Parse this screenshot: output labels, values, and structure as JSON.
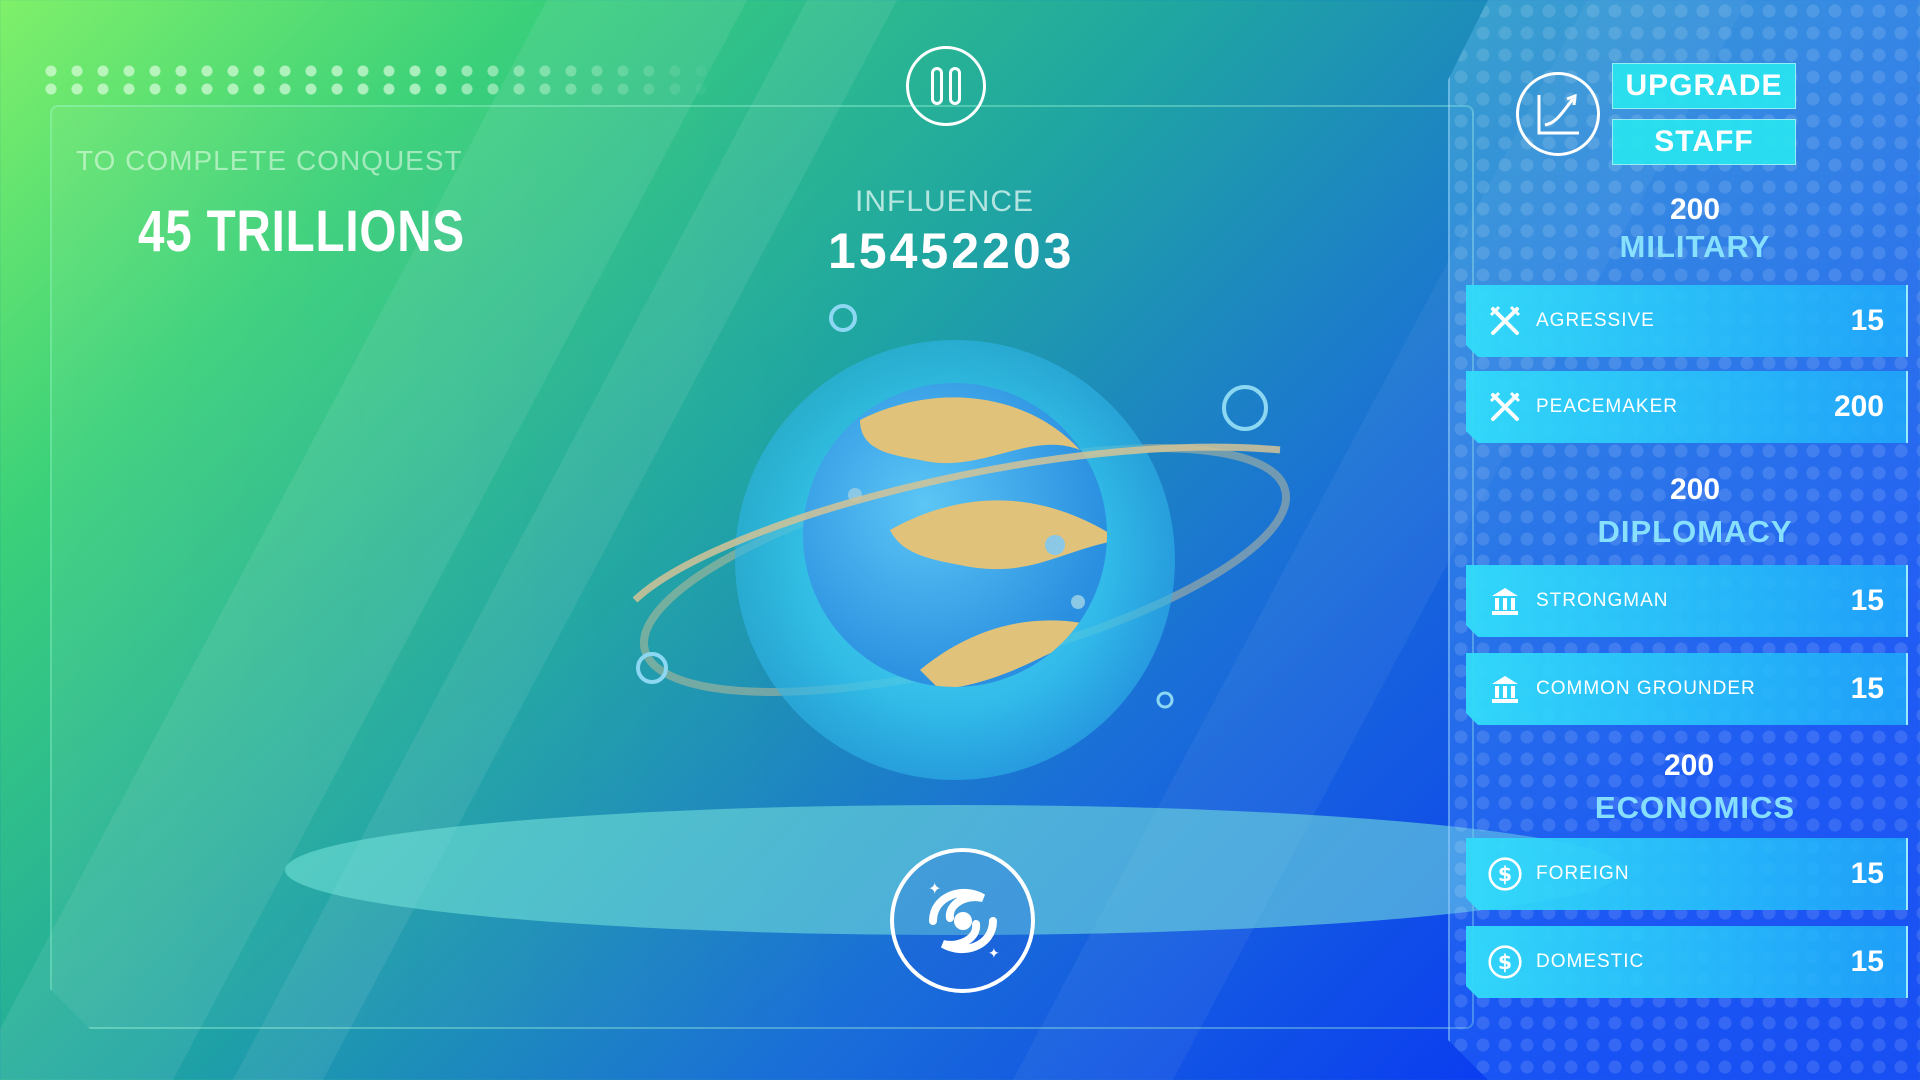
{
  "conquest": {
    "label": "TO COMPLETE CONQUEST",
    "value": "45 TRILLIONS"
  },
  "influence": {
    "label": "INFLUENCE",
    "value": "15452203"
  },
  "upgrade": {
    "upgrade_label": "UPGRADE",
    "staff_label": "STAFF"
  },
  "military": {
    "value": "200",
    "name": "MILITARY",
    "items": [
      {
        "label": "AGRESSIVE",
        "value": "15",
        "icon": "crossed-swords-icon"
      },
      {
        "label": "PEACEMAKER",
        "value": "200",
        "icon": "crossed-swords-icon"
      }
    ]
  },
  "diplomacy": {
    "value": "200",
    "name": "DIPLOMACY",
    "items": [
      {
        "label": "STRONGMAN",
        "value": "15",
        "icon": "government-building-icon"
      },
      {
        "label": "COMMON GROUNDER",
        "value": "15",
        "icon": "government-building-icon"
      }
    ]
  },
  "economics": {
    "value": "200",
    "name": "ECONOMICS",
    "items": [
      {
        "label": "FOREIGN",
        "value": "15",
        "icon": "dollar-coin-icon"
      },
      {
        "label": "DOMESTIC",
        "value": "15",
        "icon": "dollar-coin-icon"
      }
    ]
  },
  "icons": {
    "pause": "pause-icon",
    "galaxy": "galaxy-icon",
    "upgrade": "growth-chart-icon",
    "planet": "planet-icon"
  }
}
